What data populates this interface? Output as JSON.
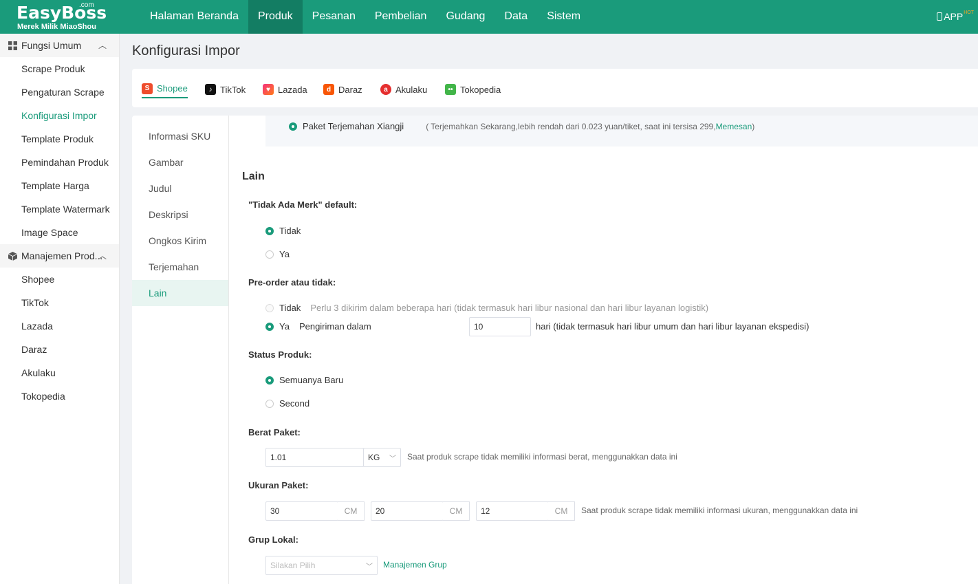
{
  "brand": {
    "name": "EasyBoss",
    "com": ".com",
    "tagline": "Merek Milik MiaoShou"
  },
  "topnav": [
    "Halaman Beranda",
    "Produk",
    "Pesanan",
    "Pembelian",
    "Gudang",
    "Data",
    "Sistem"
  ],
  "topnav_active": "Produk",
  "app": {
    "label": "APP",
    "badge": "HOT"
  },
  "sidebar": {
    "group1": "Fungsi Umum",
    "group1_items": [
      "Scrape Produk",
      "Pengaturan Scrape",
      "Konfigurasi Impor",
      "Template Produk",
      "Pemindahan Produk",
      "Template Harga",
      "Template Watermark",
      "Image Space"
    ],
    "group2": "Manajemen Prod...",
    "group2_items": [
      "Shopee",
      "TikTok",
      "Lazada",
      "Daraz",
      "Akulaku",
      "Tokopedia"
    ],
    "active": "Konfigurasi Impor"
  },
  "page_title": "Konfigurasi Impor",
  "platforms": [
    "Shopee",
    "TikTok",
    "Lazada",
    "Daraz",
    "Akulaku",
    "Tokopedia"
  ],
  "platform_active": "Shopee",
  "subnav": [
    "Informasi SKU",
    "Gambar",
    "Judul",
    "Deskripsi",
    "Ongkos Kirim",
    "Terjemahan",
    "Lain"
  ],
  "subnav_active": "Lain",
  "translation": {
    "option": "Paket Terjemahan Xiangji",
    "note_prefix": "( Terjemahkan Sekarang,lebih rendah dari 0.023 yuan/tiket, saat ini tersisa 299,",
    "note_link": "Memesan",
    "note_suffix": " )"
  },
  "section_title": "Lain",
  "no_brand": {
    "label": "\"Tidak Ada Merk\" default:",
    "opt_no": "Tidak",
    "opt_yes": "Ya",
    "selected": "Tidak"
  },
  "preorder": {
    "label": "Pre-order atau tidak:",
    "opt_no": "Tidak",
    "opt_no_hint": "Perlu 3 dikirim dalam beberapa hari (tidak termasuk hari libur nasional dan hari libur layanan logistik)",
    "opt_yes": "Ya",
    "yes_prefix": "Pengiriman dalam",
    "days": "10",
    "yes_suffix": "hari (tidak termasuk hari libur umum dan hari libur layanan ekspedisi)",
    "selected": "Ya"
  },
  "status": {
    "label": "Status Produk:",
    "opt_new": "Semuanya Baru",
    "opt_second": "Second",
    "selected": "Semuanya Baru"
  },
  "weight": {
    "label": "Berat Paket:",
    "value": "1.01",
    "unit": "KG",
    "desc": "Saat produk scrape tidak memiliki informasi berat, menggunakkan data ini"
  },
  "size": {
    "label": "Ukuran Paket:",
    "length": "30",
    "width": "20",
    "height": "12",
    "unit": "CM",
    "desc": "Saat produk scrape tidak memiliki informasi ukuran, menggunakkan data ini"
  },
  "local_group": {
    "label": "Grup Lokal:",
    "placeholder": "Silakan Pilih",
    "manage_link": "Manajemen Grup"
  }
}
